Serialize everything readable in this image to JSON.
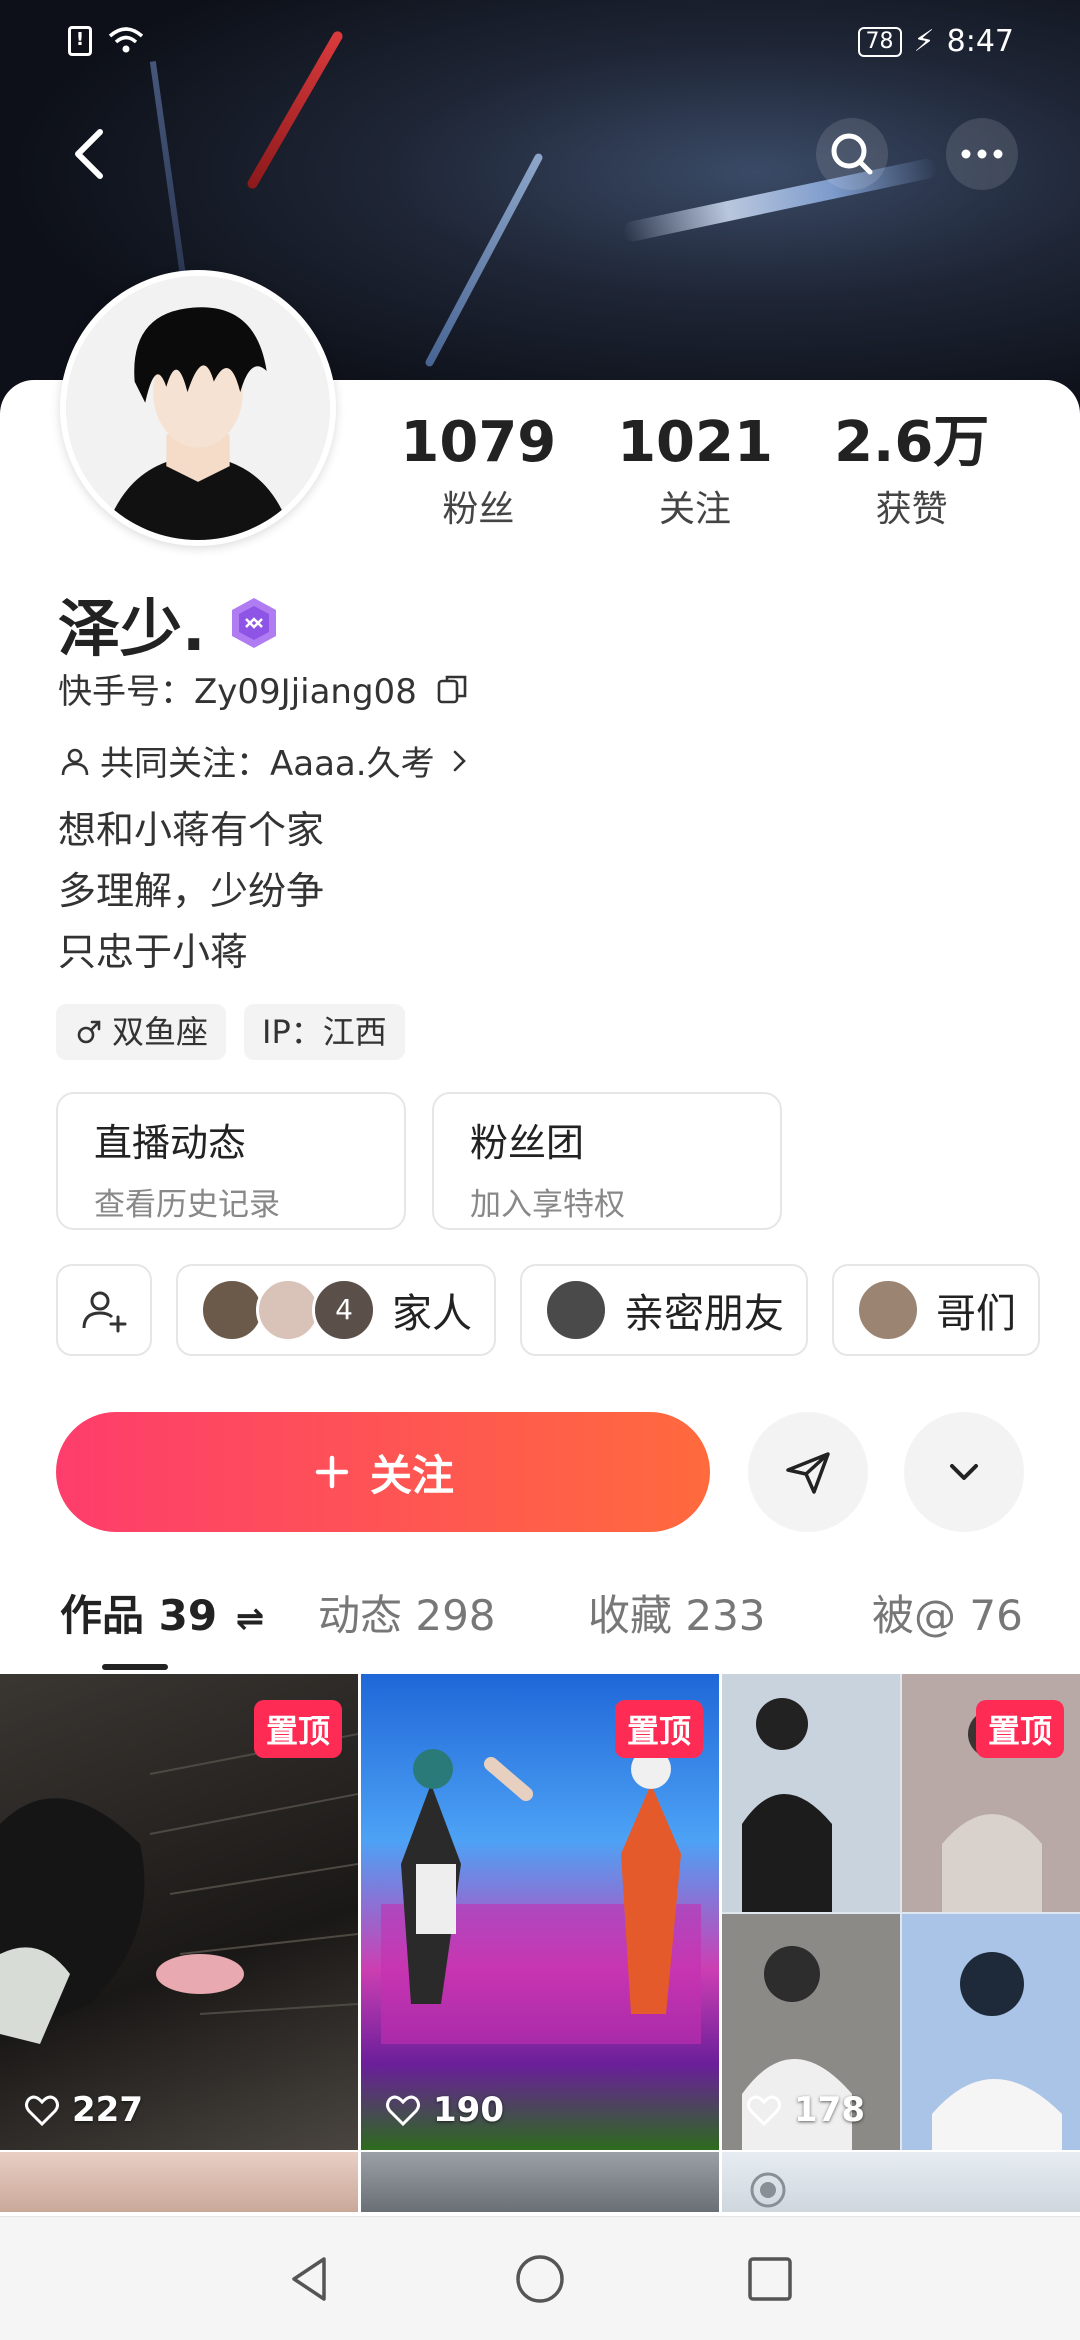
{
  "status": {
    "battery": "78",
    "time": "8:47"
  },
  "profile": {
    "name": "泽少.",
    "kuaishou_id": "快手号：Zy09Jjiang08",
    "mutual": "共同关注：Aaaa.久考",
    "bio": [
      "想和小蒋有个家",
      "多理解，少纷争",
      "只忠于小蒋"
    ],
    "tags": [
      {
        "icon": "male-icon",
        "label": "双鱼座"
      },
      {
        "label": "IP：江西"
      }
    ]
  },
  "stats": [
    {
      "value": "1079",
      "label": "粉丝"
    },
    {
      "value": "1021",
      "label": "关注"
    },
    {
      "value": "2.6万",
      "label": "获赞"
    }
  ],
  "boxes": [
    {
      "title": "直播动态",
      "subtitle": "查看历史记录"
    },
    {
      "title": "粉丝团",
      "subtitle": "加入享特权"
    }
  ],
  "groups": [
    {
      "label": "家人",
      "count": "4"
    },
    {
      "label": "亲密朋友"
    },
    {
      "label": "哥们"
    }
  ],
  "actions": {
    "follow": "关注"
  },
  "tabs": [
    {
      "label": "作品 39",
      "active": true
    },
    {
      "label": "动态 298"
    },
    {
      "label": "收藏 233"
    },
    {
      "label": "被@ 76"
    }
  ],
  "videos": [
    {
      "pinned": "置顶",
      "likes": "227"
    },
    {
      "pinned": "置顶",
      "likes": "190"
    },
    {
      "pinned": "置顶",
      "likes": "178"
    }
  ],
  "colors": {
    "accent": "#fe2c55",
    "follow_gradient_start": "#fe3d6c",
    "follow_gradient_end": "#ff6a3d"
  }
}
